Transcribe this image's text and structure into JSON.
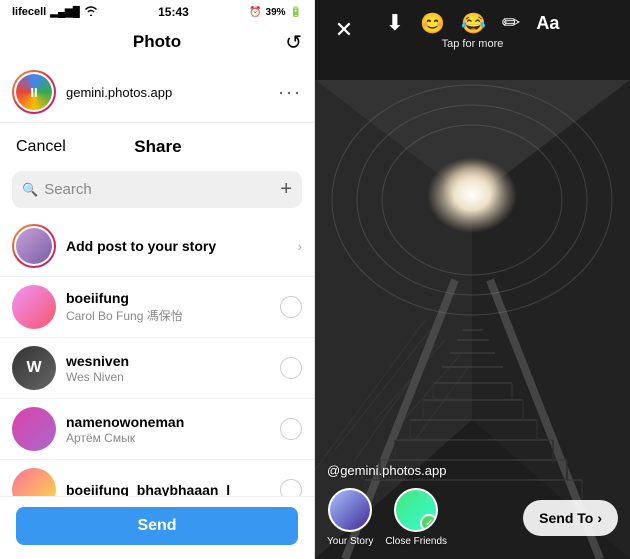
{
  "status": {
    "carrier": "lifecell",
    "time": "15:43",
    "battery": "39%"
  },
  "left": {
    "nav_title": "Photo",
    "app_name": "gemini.photos.app",
    "share_cancel": "Cancel",
    "share_title": "Share",
    "search_placeholder": "Search",
    "search_plus": "+",
    "send_label": "Send",
    "list_items": [
      {
        "type": "story",
        "name": "Add post to your story",
        "sub": "",
        "has_chevron": true,
        "has_radio": false
      },
      {
        "type": "user",
        "name": "boeiifung",
        "sub": "Carol Bo Fung 馮保怡",
        "has_chevron": false,
        "has_radio": true
      },
      {
        "type": "user",
        "name": "wesniven",
        "sub": "Wes Niven",
        "has_chevron": false,
        "has_radio": true
      },
      {
        "type": "user",
        "name": "namenowoneman",
        "sub": "Артём Смык",
        "has_chevron": false,
        "has_radio": true
      },
      {
        "type": "user",
        "name": "boeiifung_bhaybhaaan_l",
        "sub": "",
        "has_chevron": false,
        "has_radio": true
      }
    ]
  },
  "right": {
    "tap_for_more": "Tap for more",
    "username": "@gemini.photos.app",
    "your_story_label": "Your Story",
    "close_friends_label": "Close Friends",
    "send_to_label": "Send To",
    "icons": {
      "download": "⬇",
      "sticker": "☺",
      "emoji": "☻",
      "edit": "✏",
      "text": "Aa",
      "close": "✕"
    }
  }
}
